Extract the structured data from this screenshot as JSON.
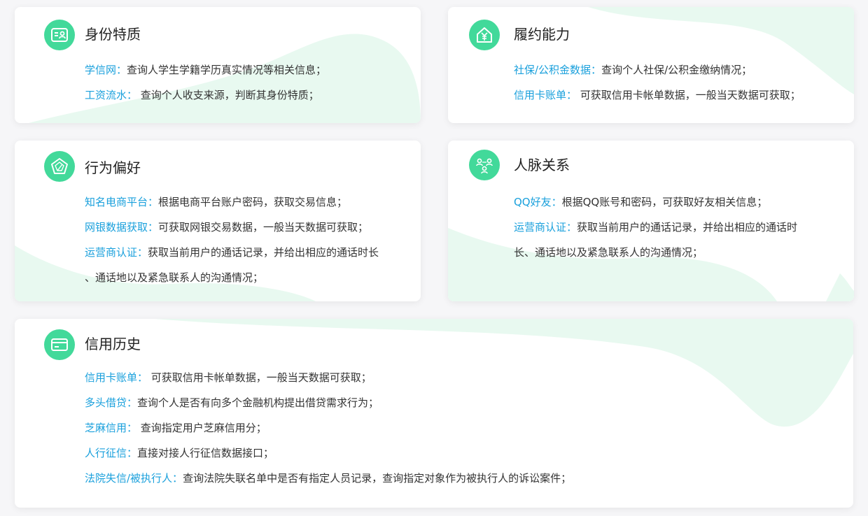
{
  "colors": {
    "accent_blue": "#1aa0dc",
    "badge_green": "#42d99a",
    "decor_green": "#e8f9f0"
  },
  "cards": [
    {
      "icon": "id-card-icon",
      "title": "身份特质",
      "rows": [
        {
          "k": "学信网：",
          "v": "查询人学生学籍学历真实情况等相关信息；"
        },
        {
          "k": "工资流水：",
          "v": " 查询个人收支来源，判断其身份特质；"
        }
      ]
    },
    {
      "icon": "house-yen-icon",
      "title": "履约能力",
      "rows": [
        {
          "k": "社保/公积金数据：",
          "v": "查询个人社保/公积金缴纳情况；"
        },
        {
          "k": "信用卡账单：",
          "v": " 可获取信用卡帐单数据，一般当天数据可获取；"
        }
      ]
    },
    {
      "icon": "pentagon-icon",
      "title": "行为偏好",
      "rows": [
        {
          "k": "知名电商平台：",
          "v": "根据电商平台账户密码，获取交易信息；"
        },
        {
          "k": "网银数据获取：",
          "v": "可获取网银交易数据，一般当天数据可获取；"
        },
        {
          "k": "运营商认证：",
          "v": "获取当前用户的通话记录，并给出相应的通话时长"
        },
        {
          "k": "",
          "v": "、通话地以及紧急联系人的沟通情况；"
        }
      ]
    },
    {
      "icon": "contacts-network-icon",
      "title": "人脉关系",
      "rows": [
        {
          "k": "QQ好友：",
          "v": "根据QQ账号和密码，可获取好友相关信息；"
        },
        {
          "k": "运营商认证：",
          "v": "获取当前用户的通话记录，并给出相应的通话时"
        },
        {
          "k": "",
          "v": "长、通话地以及紧急联系人的沟通情况；"
        }
      ]
    },
    {
      "icon": "credit-card-icon",
      "title": "信用历史",
      "rows": [
        {
          "k": "信用卡账单：",
          "v": " 可获取信用卡帐单数据，一般当天数据可获取；"
        },
        {
          "k": "多头借贷：",
          "v": "查询个人是否有向多个金融机构提出借贷需求行为；"
        },
        {
          "k": "芝麻信用：",
          "v": " 查询指定用户芝麻信用分；"
        },
        {
          "k": "人行征信：",
          "v": "直接对接人行征信数据接口；"
        },
        {
          "k": "法院失信/被执行人：",
          "v": "查询法院失联名单中是否有指定人员记录，查询指定对象作为被执行人的诉讼案件；"
        }
      ]
    }
  ]
}
